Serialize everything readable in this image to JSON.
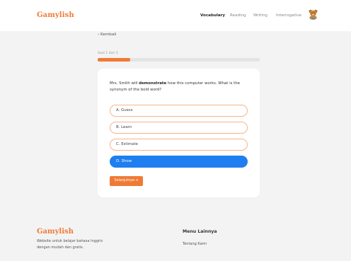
{
  "header": {
    "logo": "Gamylish",
    "nav": [
      {
        "label": "Vocabulary",
        "active": true
      },
      {
        "label": "Reading",
        "active": false
      },
      {
        "label": "Writing",
        "active": false
      },
      {
        "label": "Interrogative",
        "active": false
      }
    ],
    "avatar_icon": "teddy-bear-icon"
  },
  "main": {
    "back_label": "‹ Kembali",
    "progress": {
      "label": "Soal 1 dari 5",
      "fraction": 0.2,
      "color": "#f07a35"
    },
    "question": {
      "before": "Mrs. Smith will ",
      "bold": "demonstrate",
      "after": " how this computer works. What is the synonym of the bold word?"
    },
    "options": [
      {
        "label": "A. Guess",
        "selected": false
      },
      {
        "label": "B. Learn",
        "selected": false
      },
      {
        "label": "C. Estimate",
        "selected": false
      },
      {
        "label": "D. Show",
        "selected": true
      }
    ],
    "next_label": "Selanjutnya ➜"
  },
  "footer": {
    "logo": "Gamylish",
    "description": "Website untuk belajar bahasa Inggris dengan mudah dan gratis.",
    "menu_title": "Menu Lainnya",
    "menu_items": [
      "Tentang Kami"
    ]
  },
  "colors": {
    "accent": "#f07a35",
    "selected": "#1f7ef0",
    "option_border": "#f5b48a"
  }
}
